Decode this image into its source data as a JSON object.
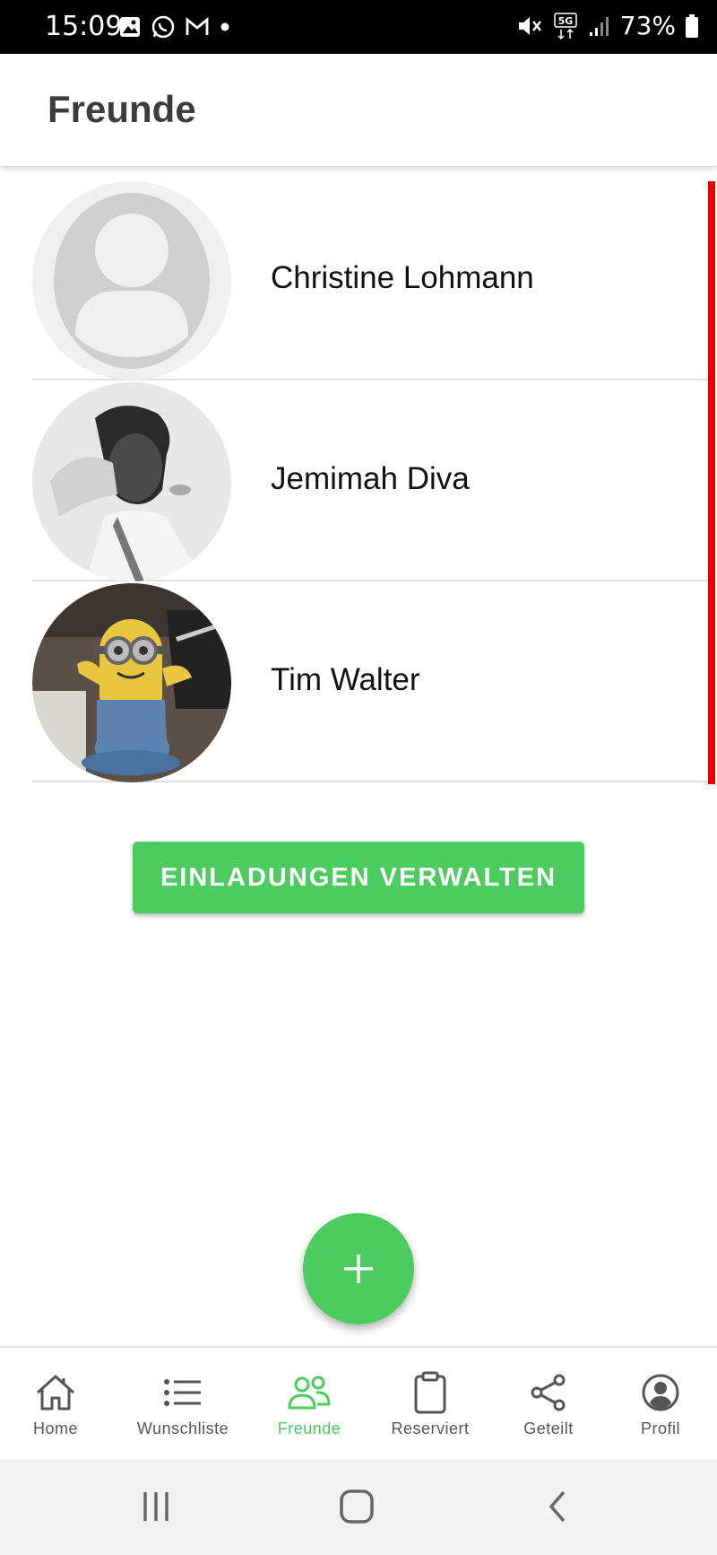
{
  "status_bar": {
    "time": "15:09",
    "battery": "73%",
    "network": "5G"
  },
  "header": {
    "title": "Freunde"
  },
  "friends": [
    {
      "name": "Christine Lohmann",
      "avatar": "placeholder-avatar"
    },
    {
      "name": "Jemimah Diva",
      "avatar": "photo-woman"
    },
    {
      "name": "Tim Walter",
      "avatar": "photo-minion-figure"
    }
  ],
  "invite_button": {
    "label": "EINLADUNGEN VERWALTEN"
  },
  "fab": {
    "icon": "plus-icon"
  },
  "bottom_nav": {
    "items": [
      {
        "label": "Home",
        "icon": "home-icon"
      },
      {
        "label": "Wunschliste",
        "icon": "list-icon"
      },
      {
        "label": "Freunde",
        "icon": "people-icon",
        "active": true
      },
      {
        "label": "Reserviert",
        "icon": "clipboard-icon"
      },
      {
        "label": "Geteilt",
        "icon": "share-icon"
      },
      {
        "label": "Profil",
        "icon": "profile-icon"
      }
    ]
  },
  "colors": {
    "accent": "#4ccb5f",
    "scroll_indicator": "#ee0000",
    "status_bar_bg": "#000000"
  }
}
